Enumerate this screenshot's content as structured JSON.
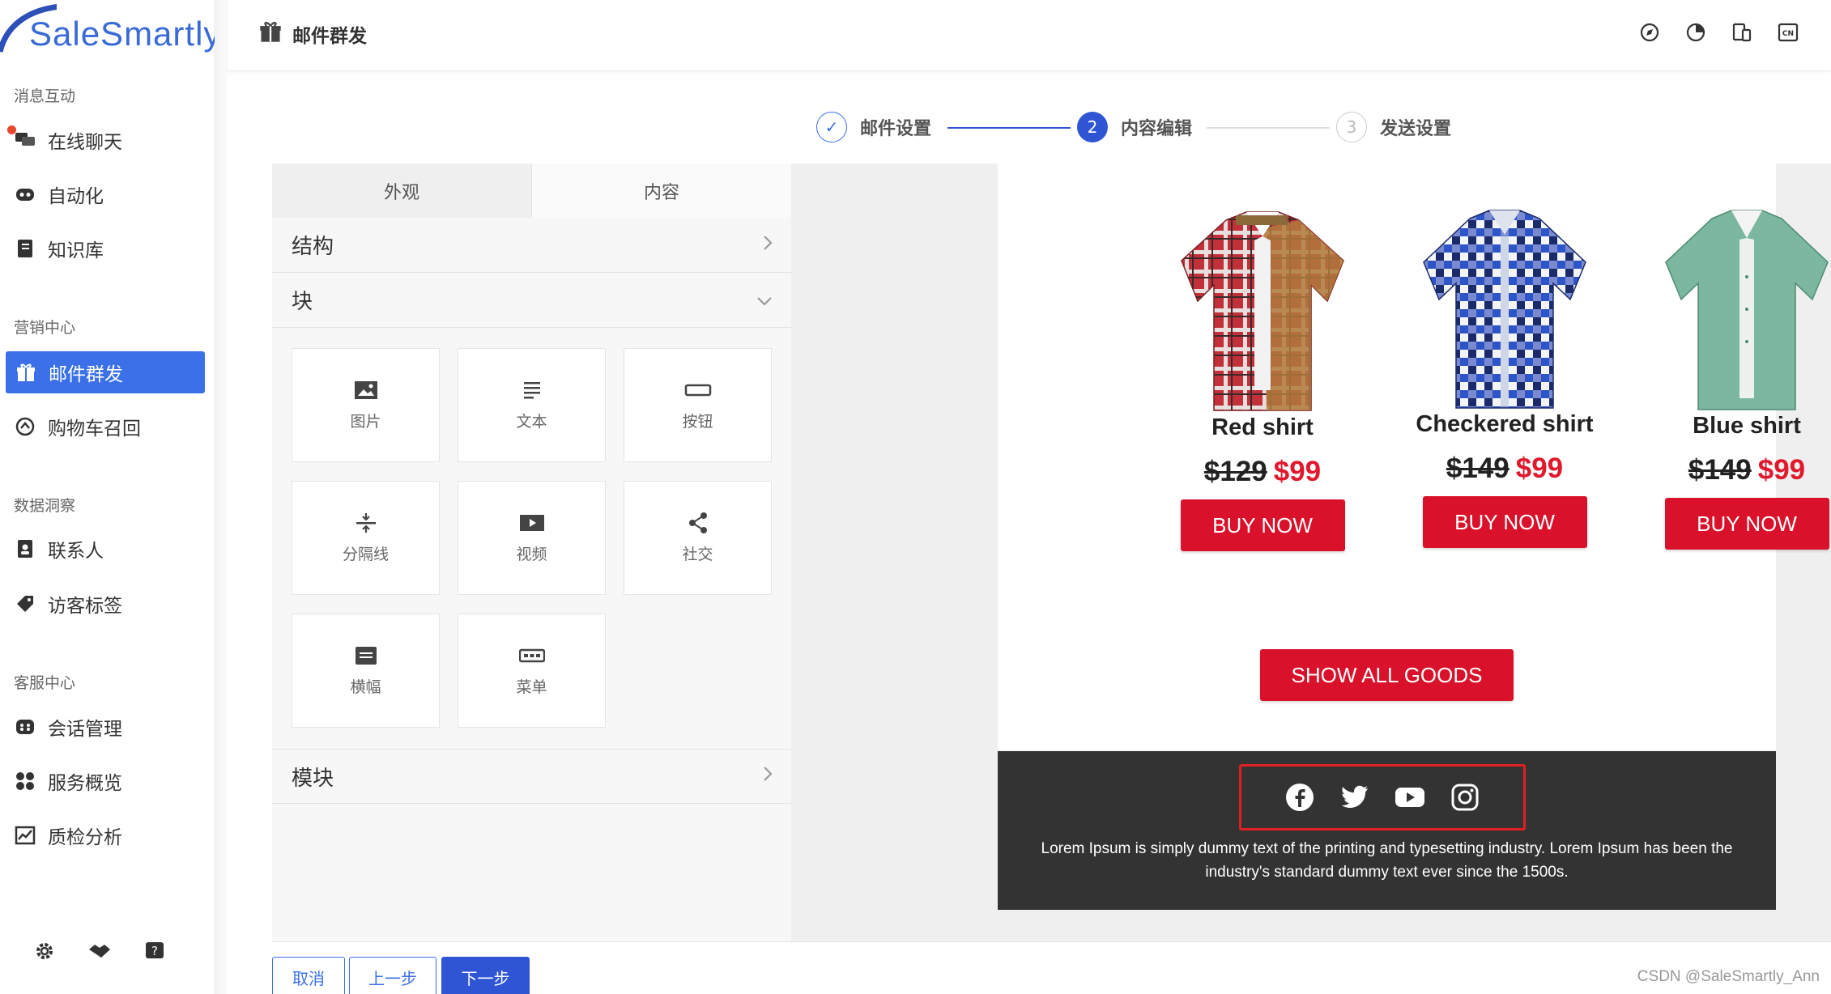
{
  "app": {
    "brand": "SaleSmartly",
    "brand_color": "#3b70e8"
  },
  "sidebar": {
    "sections": [
      {
        "title": "消息互动"
      },
      {
        "title": "营销中心"
      },
      {
        "title": "数据洞察"
      },
      {
        "title": "客服中心"
      }
    ],
    "items": [
      {
        "label": "在线聊天",
        "icon": "chat-icon"
      },
      {
        "label": "自动化",
        "icon": "robot-icon"
      },
      {
        "label": "知识库",
        "icon": "book-icon"
      },
      {
        "label": "邮件群发",
        "icon": "gift-icon",
        "active": true
      },
      {
        "label": "购物车召回",
        "icon": "cart-recall-icon"
      },
      {
        "label": "联系人",
        "icon": "contact-icon"
      },
      {
        "label": "访客标签",
        "icon": "tag-icon"
      },
      {
        "label": "会话管理",
        "icon": "session-icon"
      },
      {
        "label": "服务概览",
        "icon": "grid-icon"
      },
      {
        "label": "质检分析",
        "icon": "chart-icon"
      }
    ],
    "bottom_icons": [
      "gear-icon",
      "handshake-icon",
      "help-icon"
    ]
  },
  "header": {
    "title": "邮件群发",
    "tools": [
      "compass-icon",
      "pie-icon",
      "devices-icon",
      "language-cn-icon"
    ],
    "lang_label": "CN"
  },
  "steps": [
    {
      "num": "✓",
      "label": "邮件设置",
      "state": "done"
    },
    {
      "num": "2",
      "label": "内容编辑",
      "state": "current"
    },
    {
      "num": "3",
      "label": "发送设置",
      "state": "todo"
    }
  ],
  "editor": {
    "tabs": [
      "外观",
      "内容"
    ],
    "accordion": {
      "structure": "结构",
      "block": "块",
      "module": "模块"
    },
    "blocks": [
      {
        "label": "图片",
        "icon": "image-icon"
      },
      {
        "label": "文本",
        "icon": "text-icon"
      },
      {
        "label": "按钮",
        "icon": "button-icon"
      },
      {
        "label": "分隔线",
        "icon": "divider-icon"
      },
      {
        "label": "视频",
        "icon": "video-icon"
      },
      {
        "label": "社交",
        "icon": "share-icon"
      },
      {
        "label": "横幅",
        "icon": "banner-icon"
      },
      {
        "label": "菜单",
        "icon": "menu-icon"
      }
    ]
  },
  "preview": {
    "products": [
      {
        "name": "Red shirt",
        "old_price": "$129",
        "new_price": "$99",
        "button": "BUY NOW"
      },
      {
        "name": "Checkered shirt",
        "old_price": "$149",
        "new_price": "$99",
        "button": "BUY NOW"
      },
      {
        "name": "Blue shirt",
        "old_price": "$149",
        "new_price": "$99",
        "button": "BUY NOW"
      }
    ],
    "show_all": "SHOW ALL GOODS",
    "social": [
      "facebook-icon",
      "twitter-icon",
      "youtube-icon",
      "instagram-icon"
    ],
    "footer_text": "Lorem Ipsum is simply dummy text of the printing and typesetting industry. Lorem Ipsum has been the industry's standard dummy text ever since the 1500s.",
    "accent": "#d9112b"
  },
  "actions": {
    "cancel": "取消",
    "prev": "上一步",
    "next": "下一步"
  },
  "watermark": "CSDN @SaleSmartly_Ann"
}
